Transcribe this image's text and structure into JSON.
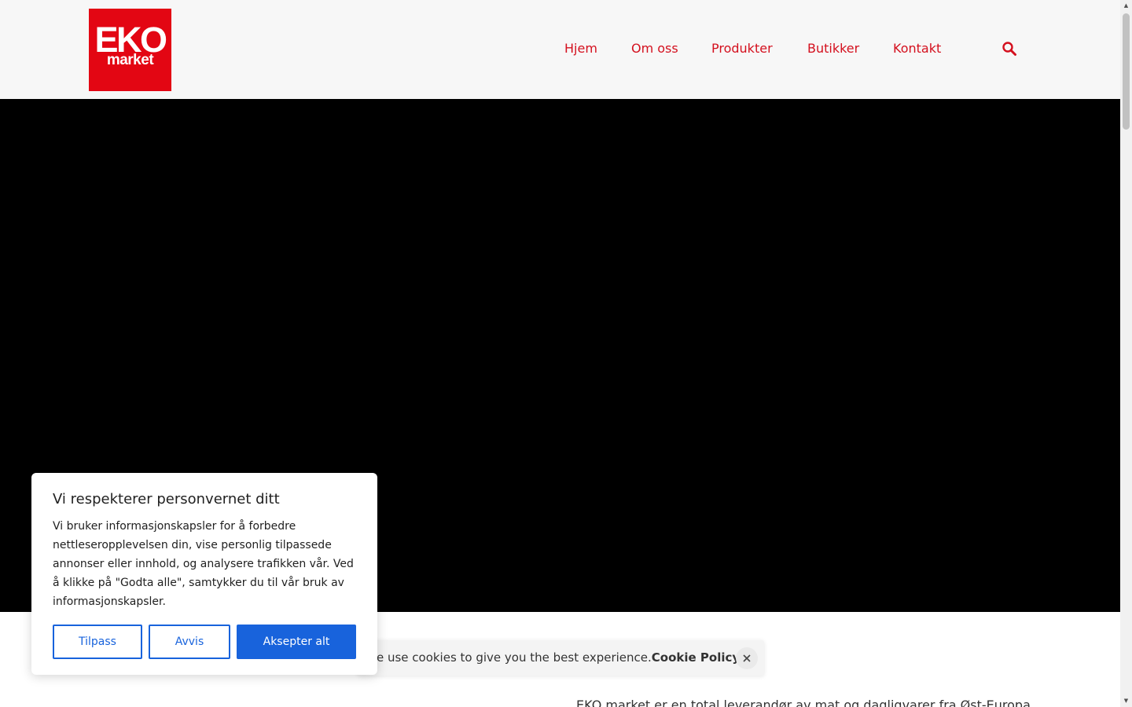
{
  "header": {
    "logo": {
      "main": "EKO",
      "sub": "market"
    },
    "nav": [
      {
        "label": "Hjem"
      },
      {
        "label": "Om oss"
      },
      {
        "label": "Produkter"
      },
      {
        "label": "Butikker"
      },
      {
        "label": "Kontakt"
      }
    ],
    "search_icon": "search-icon",
    "accent_color": "#d4101e",
    "logo_color": "#e30613"
  },
  "hero": {
    "background": "#000000"
  },
  "intro": {
    "text": "EKO market er en total leverandør av mat og dagligvarer fra Øst-Europa"
  },
  "consent": {
    "title": "Vi respekterer personvernet ditt",
    "body": "Vi bruker informasjonskapsler for å forbedre nettleseropplevelsen din, vise personlig tilpassede annonser eller innhold, og analysere trafikken vår. Ved å klikke på \"Godta alle\", samtykker du til vår bruk av informasjonskapsler.",
    "buttons": {
      "customize": "Tilpass",
      "reject": "Avvis",
      "accept": "Aksepter alt"
    },
    "button_color": "#1863dc"
  },
  "notice": {
    "text": "We use cookies to give you the best experience.",
    "link": "Cookie Policy",
    "close_icon": "close-icon"
  }
}
